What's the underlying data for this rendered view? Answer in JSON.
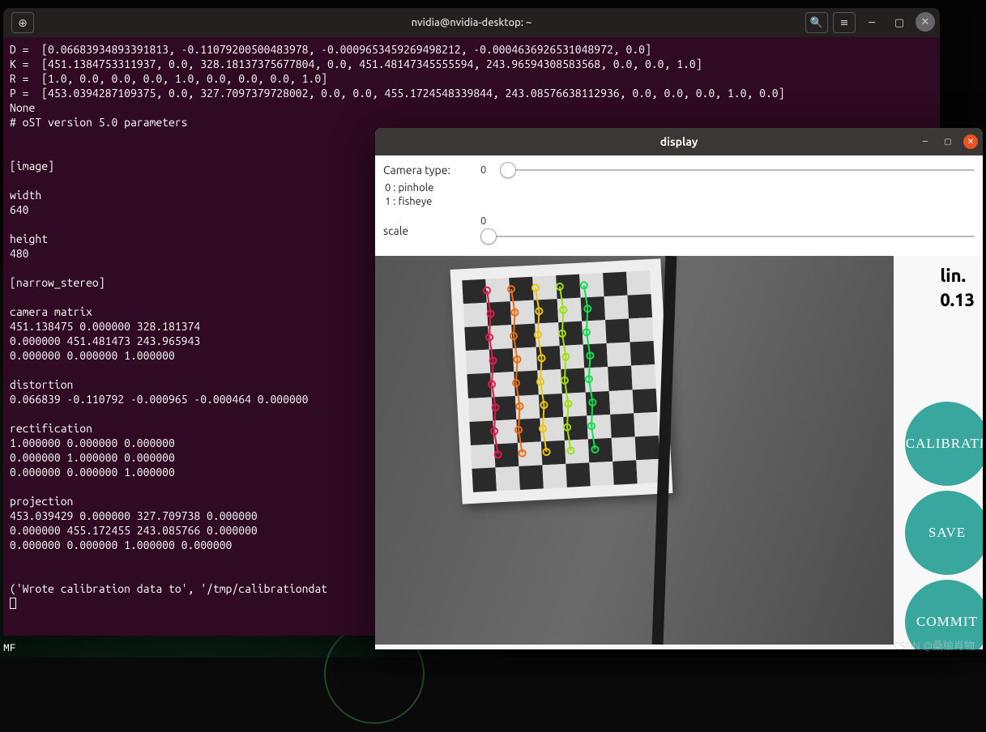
{
  "terminal": {
    "title": "nvidia@nvidia-desktop: ~",
    "output": "D =  [0.06683934893391813, -0.11079200500483978, -0.0009653459269498212, -0.0004636926531048972, 0.0]\nK =  [451.1384753311937, 0.0, 328.18137375677804, 0.0, 451.48147345555594, 243.96594308583568, 0.0, 0.0, 1.0]\nR =  [1.0, 0.0, 0.0, 0.0, 1.0, 0.0, 0.0, 0.0, 1.0]\nP =  [453.0394287109375, 0.0, 327.7097379728002, 0.0, 0.0, 455.1724548339844, 243.08576638112936, 0.0, 0.0, 0.0, 1.0, 0.0]\nNone\n# oST version 5.0 parameters\n\n\n[image]\n\nwidth\n640\n\nheight\n480\n\n[narrow_stereo]\n\ncamera matrix\n451.138475 0.000000 328.181374\n0.000000 451.481473 243.965943\n0.000000 0.000000 1.000000\n\ndistortion\n0.066839 -0.110792 -0.000965 -0.000464 0.000000\n\nrectification\n1.000000 0.000000 0.000000\n0.000000 1.000000 0.000000\n0.000000 0.000000 1.000000\n\nprojection\n453.039429 0.000000 327.709738 0.000000\n0.000000 455.172455 243.085766 0.000000\n0.000000 0.000000 1.000000 0.000000\n\n\n('Wrote calibration data to', '/tmp/calibrationdat"
  },
  "display": {
    "title": "display",
    "camera_type": {
      "label": "Camera type:",
      "legend0": "0 : pinhole",
      "legend1": "1 : fisheye",
      "value": "0"
    },
    "scale": {
      "label": "scale",
      "value": "0"
    },
    "side": {
      "line1": "lin.",
      "line2": "0.13"
    },
    "buttons": {
      "calibrate": "CALIBRATE",
      "save": "SAVE",
      "commit": "COMMIT"
    }
  },
  "watermark": "CSDN @桑榆肖物",
  "mf": "MF"
}
